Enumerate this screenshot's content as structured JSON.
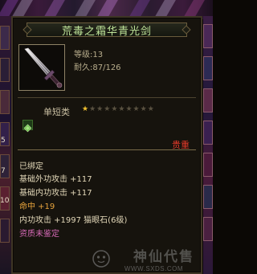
{
  "item": {
    "name": "荒毒之霜华青光剑",
    "icon": "sword-icon",
    "level_label": "等级:13",
    "durability_label": "耐久:87/126",
    "type_label": "单短类",
    "stars_total": 10,
    "stars_filled": 1,
    "gem_icon": "gem-icon",
    "rarity": "贵重",
    "bound": "已绑定",
    "attributes": [
      {
        "text": "基础外功攻击 +117",
        "color": "#e2d7b8"
      },
      {
        "text": "基础内功攻击 +117",
        "color": "#e2d7b8"
      },
      {
        "text": "命中 +19",
        "color": "#e6a33c"
      },
      {
        "text": "内功攻击 +1997 猫眼石(6级)",
        "color": "#e2d7b8"
      }
    ],
    "aptitude": "资质未鉴定"
  },
  "background": {
    "side_numbers": [
      "5",
      "7",
      "10"
    ]
  },
  "watermark": {
    "logo_text": "神仙代售",
    "url_text": "WWW.SXDS.COM"
  },
  "colors": {
    "title": "#bfe59a",
    "rarity": "#e33a2a",
    "star_on": "#f0c030",
    "aptitude": "#d66ab6",
    "orange": "#e6a33c"
  }
}
